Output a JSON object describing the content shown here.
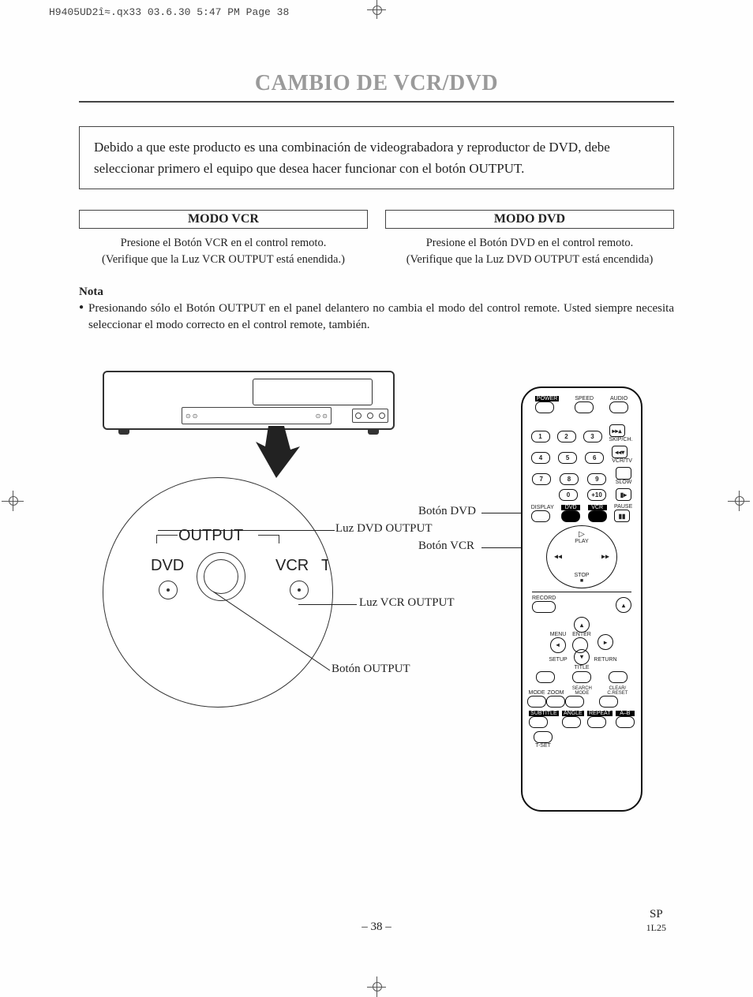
{
  "header": {
    "print_info": "H9405UD2î≈.qx33  03.6.30 5:47 PM  Page 38"
  },
  "title": "CAMBIO DE VCR/DVD",
  "intro": "Debido a que este producto es una combinación de videograbadora y reproductor de DVD, debe seleccionar primero el equipo que desea hacer funcionar con el botón OUTPUT.",
  "modes": {
    "vcr": {
      "heading": "MODO VCR",
      "line1": "Presione el Botón VCR en el control remoto.",
      "line2": "(Verifique que la Luz VCR OUTPUT está enendida.)"
    },
    "dvd": {
      "heading": "MODO DVD",
      "line1": "Presione el Botón DVD en el control remoto.",
      "line2": "(Verifique que la Luz DVD OUTPUT está encendida)"
    }
  },
  "nota": {
    "label": "Nota",
    "items": [
      "Presionando sólo el Botón OUTPUT en el panel delantero no cambia el modo del control remote. Usted siempre necesita seleccionar el modo correcto en el control remote, también."
    ]
  },
  "diagram": {
    "callouts": {
      "boton_dvd": "Botón DVD",
      "luz_dvd": "Luz DVD OUTPUT",
      "boton_vcr": "Botón VCR",
      "luz_vcr": "Luz VCR OUTPUT",
      "boton_output": "Botón OUTPUT"
    },
    "zoom": {
      "output": "OUTPUT",
      "dvd": "DVD",
      "vcr": "VCR",
      "tl": "TI"
    }
  },
  "remote": {
    "top_row": {
      "power": "POWER",
      "speed": "SPEED",
      "audio": "AUDIO"
    },
    "numpad": [
      "1",
      "2",
      "3",
      "4",
      "5",
      "6",
      "7",
      "8",
      "9",
      "0",
      "+10"
    ],
    "side_labels": {
      "skipch": "SKIP/CH.",
      "vcrtv": "VCR/TV",
      "slow": "SLOW",
      "pause": "PAUSE"
    },
    "mode_row": {
      "display": "DISPLAY",
      "dvd": "DVD",
      "vcr": "VCR"
    },
    "transport": {
      "play": "PLAY",
      "stop": "STOP"
    },
    "mid_labels": {
      "record": "RECORD",
      "menu": "MENU",
      "enter": "ENTER",
      "setup": "SETUP",
      "title": "TITLE",
      "return": "RETURN"
    },
    "bottom_row1": {
      "mode": "MODE",
      "zoom": "ZOOM",
      "search": "SEARCH MODE",
      "clear": "CLEAR/ C.RESET"
    },
    "bottom_row2": {
      "subtitle": "SUBTITLE",
      "angle": "ANGLE",
      "repeat": "REPEAT",
      "ab": "A–B"
    },
    "tset": "T-SET"
  },
  "footer": {
    "page": "– 38 –",
    "sp": "SP",
    "code": "1L25"
  }
}
